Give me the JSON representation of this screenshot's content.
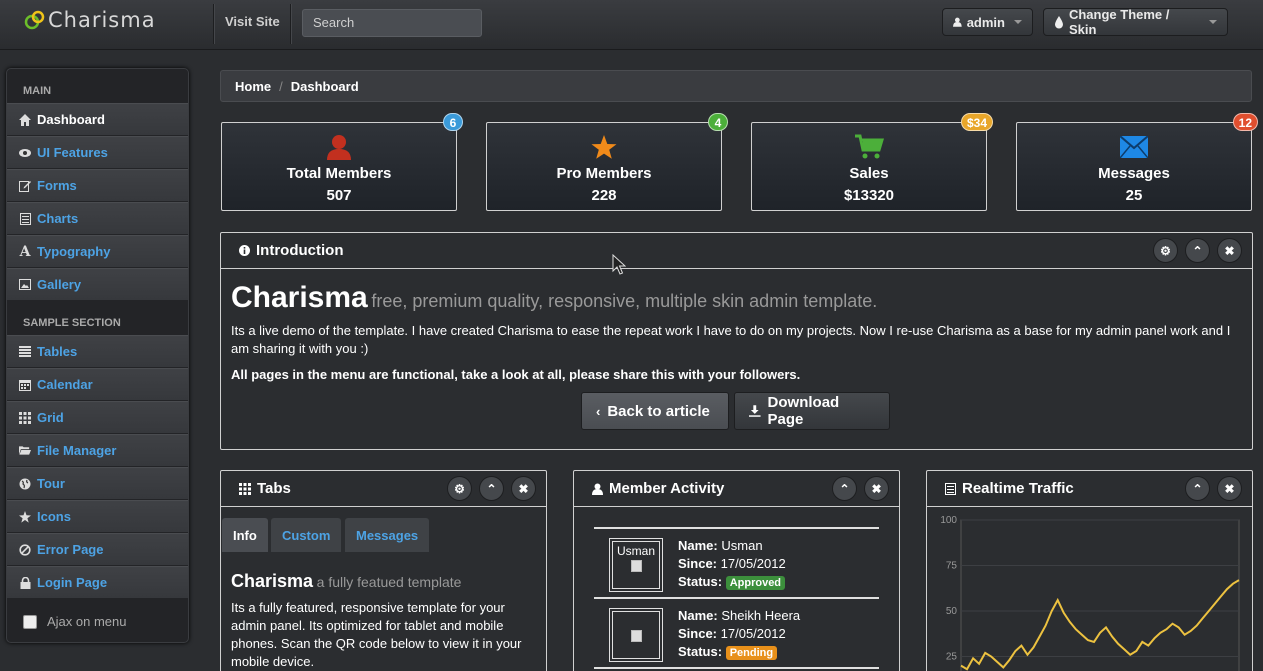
{
  "brand": {
    "name": "Charisma"
  },
  "topbar": {
    "visit_site": "Visit Site",
    "search_placeholder": "Search",
    "user_label": "admin",
    "theme_label": "Change Theme / Skin"
  },
  "sidebar": {
    "sections": [
      {
        "title": "MAIN"
      },
      {
        "title": "SAMPLE SECTION"
      }
    ],
    "main_items": [
      {
        "label": "Dashboard",
        "icon": "home-icon"
      },
      {
        "label": "UI Features",
        "icon": "eye-icon"
      },
      {
        "label": "Forms",
        "icon": "edit-icon"
      },
      {
        "label": "Charts",
        "icon": "list-icon"
      },
      {
        "label": "Typography",
        "icon": "font-icon"
      },
      {
        "label": "Gallery",
        "icon": "picture-icon"
      }
    ],
    "sample_items": [
      {
        "label": "Tables",
        "icon": "align-justify-icon"
      },
      {
        "label": "Calendar",
        "icon": "calendar-icon"
      },
      {
        "label": "Grid",
        "icon": "th-icon"
      },
      {
        "label": "File Manager",
        "icon": "folder-open-icon"
      },
      {
        "label": "Tour",
        "icon": "globe-icon"
      },
      {
        "label": "Icons",
        "icon": "star-icon"
      },
      {
        "label": "Error Page",
        "icon": "ban-icon"
      },
      {
        "label": "Login Page",
        "icon": "lock-icon"
      }
    ],
    "ajax_label": "Ajax on menu"
  },
  "breadcrumb": {
    "items": [
      "Home",
      "Dashboard"
    ],
    "divider": "/"
  },
  "stats": [
    {
      "title": "Total Members",
      "value": "507",
      "badge": "6",
      "badge_color": "#3a9ad9",
      "icon": "user-icon",
      "icon_color": "#c2301f"
    },
    {
      "title": "Pro Members",
      "value": "228",
      "badge": "4",
      "badge_color": "#4caf3a",
      "icon": "star-icon",
      "icon_color": "#f08a1a"
    },
    {
      "title": "Sales",
      "value": "$13320",
      "badge": "$34",
      "badge_color": "#e8a62a",
      "icon": "cart-icon",
      "icon_color": "#4caf3a"
    },
    {
      "title": "Messages",
      "value": "25",
      "badge": "12",
      "badge_color": "#e04f2f",
      "icon": "envelope-icon",
      "icon_color": "#1e88e5"
    }
  ],
  "intro": {
    "title": "Introduction",
    "heading": "Charisma",
    "subheading": "free, premium quality, responsive, multiple skin admin template.",
    "paragraph1": "Its a live demo of the template. I have created Charisma to ease the repeat work I have to do on my projects. Now I re-use Charisma as a base for my admin panel work and I am sharing it with you :)",
    "paragraph2": "All pages in the menu are functional, take a look at all, please share this with your followers.",
    "btn_back": "Back to article",
    "btn_download": "Download Page"
  },
  "tabs_box": {
    "title": "Tabs",
    "tabs": [
      "Info",
      "Custom",
      "Messages"
    ],
    "heading": "Charisma",
    "subheading": "a fully featued template",
    "text": "Its a fully featured, responsive template for your admin panel. Its optimized for tablet and mobile phones. Scan the QR code below to view it in your mobile device."
  },
  "activity": {
    "title": "Member Activity",
    "members": [
      {
        "avatar_alt": "Usman",
        "name": "Usman",
        "since": "17/05/2012",
        "status": "Approved",
        "status_color": "#3c8f3c"
      },
      {
        "avatar_alt": "",
        "name": "Sheikh Heera",
        "since": "17/05/2012",
        "status": "Pending",
        "status_color": "#e8901a"
      }
    ],
    "labels": {
      "name": "Name:",
      "since": "Since:",
      "status": "Status:"
    }
  },
  "traffic": {
    "title": "Realtime Traffic"
  },
  "chart_data": {
    "type": "line",
    "title": "",
    "ylim": [
      0,
      100
    ],
    "yticks": [
      "100",
      "75",
      "50",
      "25"
    ],
    "series": [
      {
        "values": [
          20,
          18,
          24,
          21,
          27,
          25,
          22,
          19,
          23,
          28,
          31,
          26,
          30,
          36,
          42,
          50,
          56,
          49,
          44,
          40,
          37,
          34,
          33,
          38,
          41,
          36,
          32,
          29,
          26,
          28,
          33,
          31,
          35,
          38,
          40,
          43,
          41,
          37,
          39,
          42,
          46,
          50,
          54,
          58,
          62,
          65,
          67
        ]
      }
    ]
  }
}
